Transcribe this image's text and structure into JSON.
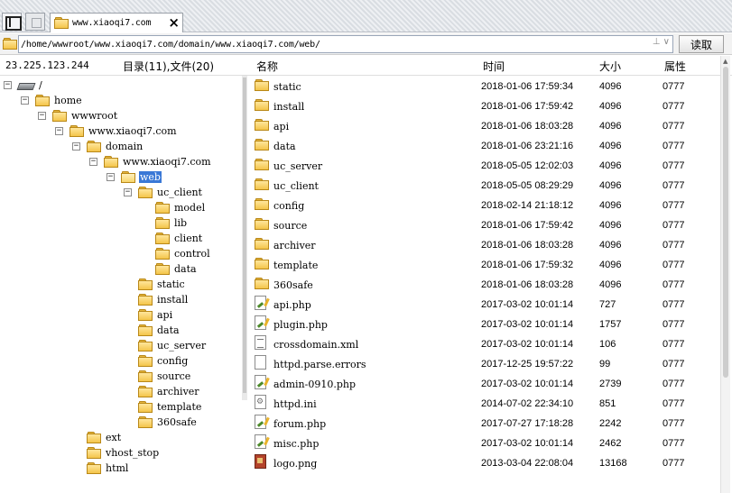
{
  "toolbar": {
    "tab": {
      "title": "www.xiaoqi7.com",
      "close": "×"
    }
  },
  "address": {
    "path": "/home/wwwroot/www.xiaoqi7.com/domain/www.xiaoqi7.com/web/",
    "controls": "⊥ ∨",
    "read_label": "读取"
  },
  "header": {
    "host": "23.225.123.244",
    "counts": "目录(11),文件(20)",
    "col_name": "名称",
    "col_time": "时间",
    "col_size": "大小",
    "col_attr": "属性"
  },
  "tree": {
    "nodes": [
      {
        "label": "/",
        "toggle": "−",
        "icon": "drive-icon"
      },
      {
        "label": "home",
        "toggle": "−"
      },
      {
        "label": "wwwroot",
        "toggle": "−"
      },
      {
        "label": "www.xiaoqi7.com",
        "toggle": "−"
      },
      {
        "label": "domain",
        "toggle": "−"
      },
      {
        "label": "www.xiaoqi7.com",
        "toggle": "−"
      },
      {
        "label": "web",
        "toggle": "−",
        "selected": true
      },
      {
        "label": "uc_client",
        "toggle": "−"
      },
      {
        "label": "model"
      },
      {
        "label": "lib"
      },
      {
        "label": "client"
      },
      {
        "label": "control"
      },
      {
        "label": "data"
      },
      {
        "label": "static"
      },
      {
        "label": "install"
      },
      {
        "label": "api"
      },
      {
        "label": "data"
      },
      {
        "label": "uc_server"
      },
      {
        "label": "config"
      },
      {
        "label": "source"
      },
      {
        "label": "archiver"
      },
      {
        "label": "template"
      },
      {
        "label": "360safe"
      },
      {
        "label": "ext"
      },
      {
        "label": "vhost_stop"
      },
      {
        "label": "html"
      }
    ]
  },
  "files": [
    {
      "name": "static",
      "time": "2018-01-06 17:59:34",
      "size": "4096",
      "attr": "0777",
      "icon": "folder-icon"
    },
    {
      "name": "install",
      "time": "2018-01-06 17:59:42",
      "size": "4096",
      "attr": "0777",
      "icon": "folder-icon"
    },
    {
      "name": "api",
      "time": "2018-01-06 18:03:28",
      "size": "4096",
      "attr": "0777",
      "icon": "folder-icon"
    },
    {
      "name": "data",
      "time": "2018-01-06 23:21:16",
      "size": "4096",
      "attr": "0777",
      "icon": "folder-icon"
    },
    {
      "name": "uc_server",
      "time": "2018-05-05 12:02:03",
      "size": "4096",
      "attr": "0777",
      "icon": "folder-icon"
    },
    {
      "name": "uc_client",
      "time": "2018-05-05 08:29:29",
      "size": "4096",
      "attr": "0777",
      "icon": "folder-icon"
    },
    {
      "name": "config",
      "time": "2018-02-14 21:18:12",
      "size": "4096",
      "attr": "0777",
      "icon": "folder-icon"
    },
    {
      "name": "source",
      "time": "2018-01-06 17:59:42",
      "size": "4096",
      "attr": "0777",
      "icon": "folder-icon"
    },
    {
      "name": "archiver",
      "time": "2018-01-06 18:03:28",
      "size": "4096",
      "attr": "0777",
      "icon": "folder-icon"
    },
    {
      "name": "template",
      "time": "2018-01-06 17:59:32",
      "size": "4096",
      "attr": "0777",
      "icon": "folder-icon"
    },
    {
      "name": "360safe",
      "time": "2018-01-06 18:03:28",
      "size": "4096",
      "attr": "0777",
      "icon": "folder-icon"
    },
    {
      "name": "api.php",
      "time": "2017-03-02 10:01:14",
      "size": "727",
      "attr": "0777",
      "icon": "php-file-icon"
    },
    {
      "name": "plugin.php",
      "time": "2017-03-02 10:01:14",
      "size": "1757",
      "attr": "0777",
      "icon": "php-file-icon"
    },
    {
      "name": "crossdomain.xml",
      "time": "2017-03-02 10:01:14",
      "size": "106",
      "attr": "0777",
      "icon": "xml-file-icon"
    },
    {
      "name": "httpd.parse.errors",
      "time": "2017-12-25 19:57:22",
      "size": "99",
      "attr": "0777",
      "icon": "blank-file-icon"
    },
    {
      "name": "admin-0910.php",
      "time": "2017-03-02 10:01:14",
      "size": "2739",
      "attr": "0777",
      "icon": "php-file-icon"
    },
    {
      "name": "httpd.ini",
      "time": "2014-07-02 22:34:10",
      "size": "851",
      "attr": "0777",
      "icon": "ini-file-icon"
    },
    {
      "name": "forum.php",
      "time": "2017-07-27 17:18:28",
      "size": "2242",
      "attr": "0777",
      "icon": "php-file-icon"
    },
    {
      "name": "misc.php",
      "time": "2017-03-02 10:01:14",
      "size": "2462",
      "attr": "0777",
      "icon": "php-file-icon"
    },
    {
      "name": "logo.png",
      "time": "2013-03-04 22:08:04",
      "size": "13168",
      "attr": "0777",
      "icon": "image-file-icon"
    }
  ]
}
